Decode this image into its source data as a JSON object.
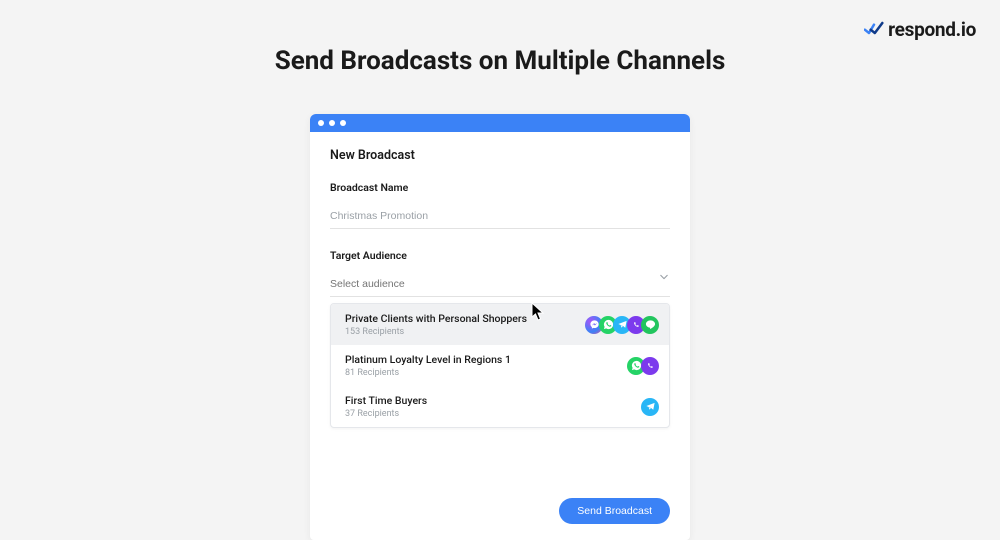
{
  "brand": {
    "name": "respond.io"
  },
  "headline": "Send Broadcasts on Multiple Channels",
  "panel": {
    "title": "New Broadcast",
    "name_label": "Broadcast Name",
    "name_value": "Christmas Promotion",
    "audience_label": "Target Audience",
    "audience_placeholder": "Select audience",
    "submit_label": "Send Broadcast"
  },
  "audiences": [
    {
      "title": "Private Clients with Personal Shoppers",
      "sub": "153 Recipients",
      "channels": [
        "messenger",
        "whatsapp",
        "telegram",
        "viber",
        "line"
      ],
      "hover": true
    },
    {
      "title": "Platinum Loyalty Level in Regions 1",
      "sub": "81 Recipients",
      "channels": [
        "whatsapp",
        "viber"
      ],
      "hover": false
    },
    {
      "title": "First Time Buyers",
      "sub": "37 Recipients",
      "channels": [
        "telegram"
      ],
      "hover": false
    }
  ]
}
